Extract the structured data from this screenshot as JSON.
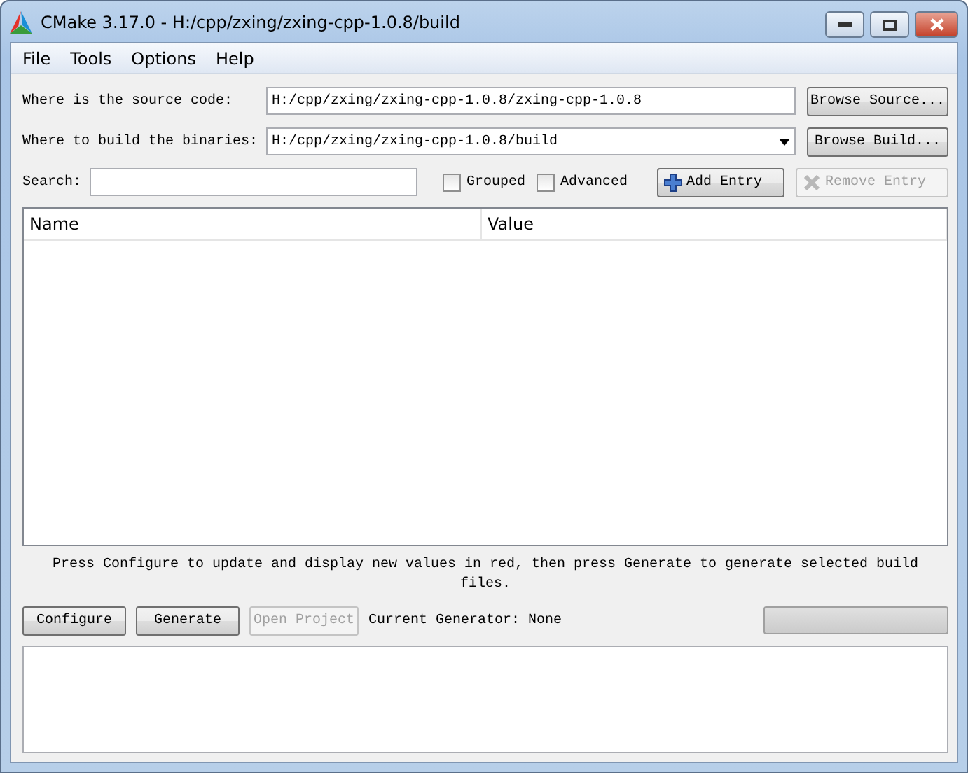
{
  "window": {
    "title": "CMake 3.17.0 - H:/cpp/zxing/zxing-cpp-1.0.8/build"
  },
  "menu": [
    "File",
    "Tools",
    "Options",
    "Help"
  ],
  "source": {
    "label": "Where is the source code:",
    "value": "H:/cpp/zxing/zxing-cpp-1.0.8/zxing-cpp-1.0.8",
    "button": "Browse Source..."
  },
  "build": {
    "label": "Where to build the binaries:",
    "value": "H:/cpp/zxing/zxing-cpp-1.0.8/build",
    "button": "Browse Build..."
  },
  "search": {
    "label": "Search:"
  },
  "options": [
    {
      "label": "Grouped",
      "checked": false
    },
    {
      "label": "Advanced",
      "checked": false
    }
  ],
  "entry_buttons": [
    {
      "kind": "add",
      "label": "Add Entry",
      "disabled": false
    },
    {
      "kind": "remove",
      "label": "Remove Entry",
      "disabled": true
    }
  ],
  "table": {
    "columns": [
      "Name",
      "Value"
    ]
  },
  "message": "Press Configure to update and display new values in red, then press Generate to generate selected build files.",
  "actions": [
    {
      "label": "Configure",
      "disabled": false
    },
    {
      "label": "Generate",
      "disabled": false
    },
    {
      "label": "Open Project",
      "disabled": true
    }
  ],
  "generator": "Current Generator: None",
  "progress": {
    "level": 0
  }
}
